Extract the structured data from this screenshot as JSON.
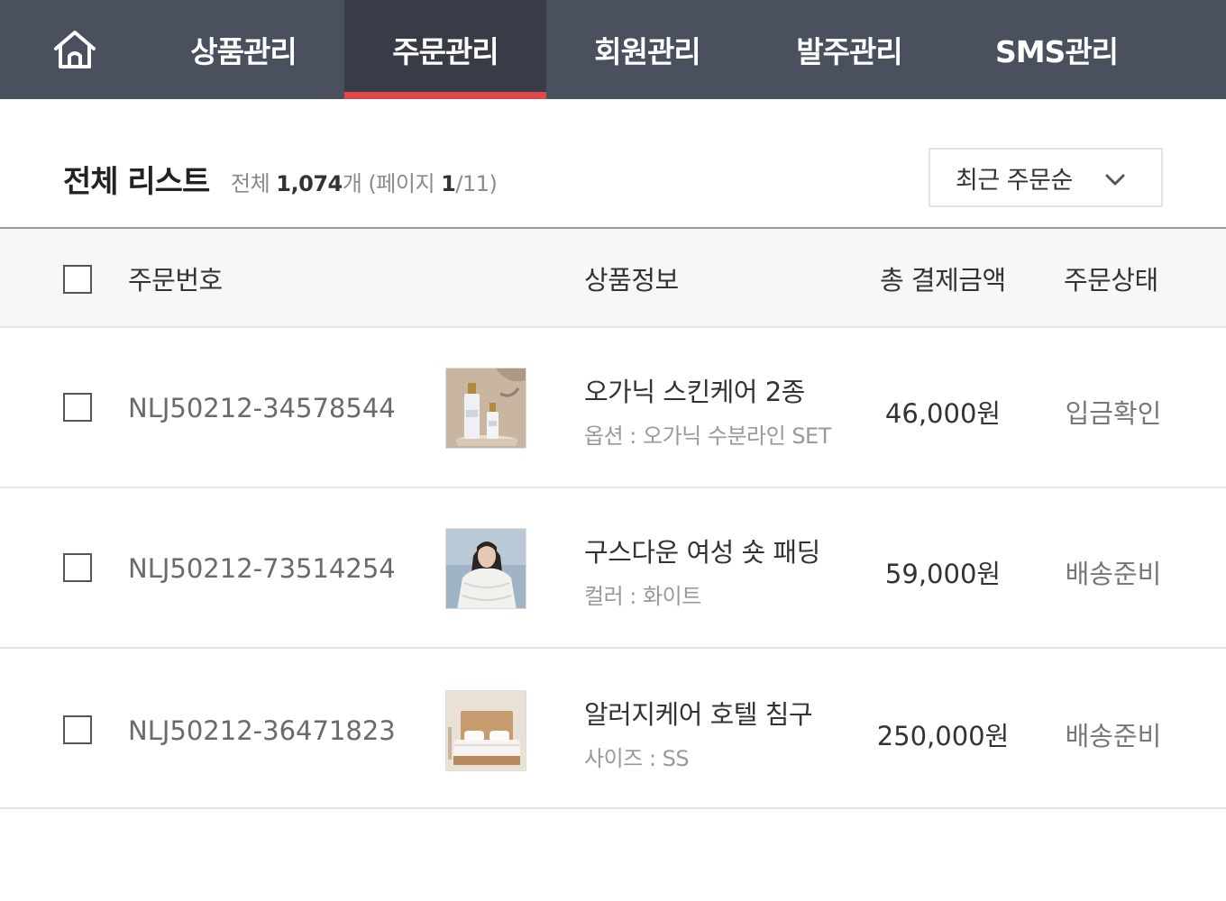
{
  "nav": {
    "home_icon": "home-icon",
    "items": [
      {
        "label": "상품관리"
      },
      {
        "label": "주문관리"
      },
      {
        "label": "회원관리"
      },
      {
        "label": "발주관리"
      },
      {
        "label": "SMS관리"
      }
    ],
    "active_index": 1,
    "background_color": "#4a505e",
    "active_background_color": "#383c46",
    "active_indicator_color": "#e2474b"
  },
  "list": {
    "title": "전체 리스트",
    "total_prefix": "전체 ",
    "total_count": "1,074",
    "total_suffix": "개 (페이지 ",
    "page_current": "1",
    "page_sep": "/11)",
    "sort": {
      "selected": "최근 주문순",
      "icon": "chevron-down-icon"
    }
  },
  "table": {
    "headers": {
      "order_no": "주문번호",
      "product": "상품정보",
      "total": "총 결제금액",
      "status": "주문상태"
    },
    "rows": [
      {
        "order_no": "NLJ50212-34578544",
        "product_name": "오가닉 스킨케어 2종",
        "product_option": "옵션 : 오가닉 수분라인 SET",
        "price": "46,000원",
        "status": "입금확인",
        "thumb": "skincare-bottles-image"
      },
      {
        "order_no": "NLJ50212-73514254",
        "product_name": "구스다운 여성 숏 패딩",
        "product_option": "컬러 : 화이트",
        "price": "59,000원",
        "status": "배송준비",
        "thumb": "white-padding-jacket-image"
      },
      {
        "order_no": "NLJ50212-36471823",
        "product_name": "알러지케어 호텔 침구",
        "product_option": "사이즈 : SS",
        "price": "250,000원",
        "status": "배송준비",
        "thumb": "hotel-bedding-image"
      }
    ]
  }
}
